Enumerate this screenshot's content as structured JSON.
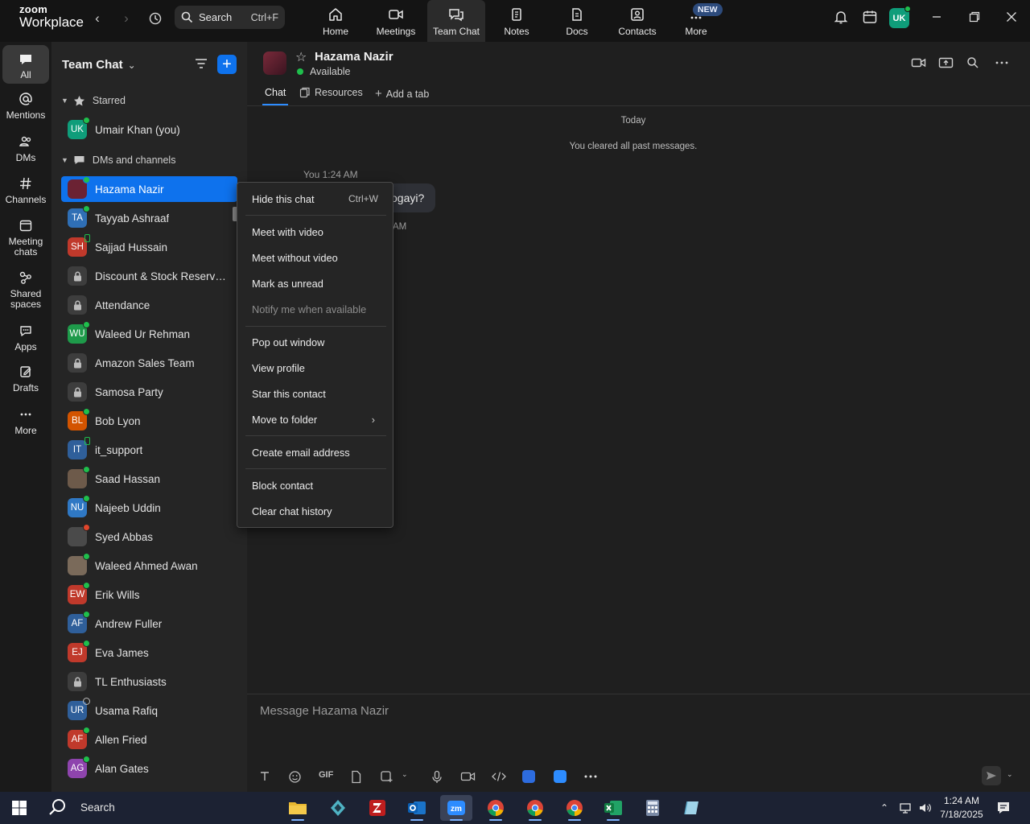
{
  "topbar": {
    "logo_line1": "zoom",
    "logo_line2": "Workplace",
    "search_label": "Search",
    "search_shortcut": "Ctrl+F",
    "nav": [
      {
        "label": "Home",
        "icon": "home-icon"
      },
      {
        "label": "Meetings",
        "icon": "video-icon"
      },
      {
        "label": "Team Chat",
        "icon": "chat-icon"
      },
      {
        "label": "Notes",
        "icon": "notes-icon"
      },
      {
        "label": "Docs",
        "icon": "docs-icon"
      },
      {
        "label": "Contacts",
        "icon": "contacts-icon"
      },
      {
        "label": "More",
        "icon": "more-icon"
      }
    ],
    "new_badge": "NEW",
    "user_initials": "UK"
  },
  "rail": [
    {
      "label": "All"
    },
    {
      "label": "Mentions"
    },
    {
      "label": "DMs"
    },
    {
      "label": "Channels"
    },
    {
      "label": "Meeting chats"
    },
    {
      "label": "Shared spaces"
    },
    {
      "label": "Apps"
    },
    {
      "label": "Drafts"
    },
    {
      "label": "More"
    }
  ],
  "panel": {
    "title": "Team Chat",
    "section_starred": "Starred",
    "section_dms": "DMs and channels",
    "starred": [
      {
        "name": "Umair Khan (you)",
        "initials": "UK",
        "color": "#0f9d7a",
        "status": "online"
      }
    ],
    "items": [
      {
        "name": "Hazama Nazir",
        "initials": "",
        "color": "#6b2233",
        "status": "online",
        "selected": true
      },
      {
        "name": "Tayyab Ashraaf",
        "initials": "TA",
        "color": "#2f6fb5",
        "status": "online"
      },
      {
        "name": "Sajjad Hussain",
        "initials": "SH",
        "color": "#c0392b",
        "status": "mobile"
      },
      {
        "name": "Discount & Stock Reservati...",
        "initials": "",
        "color": "#3d3d3d",
        "status": "lock"
      },
      {
        "name": "Attendance",
        "initials": "",
        "color": "#3d3d3d",
        "status": "lock"
      },
      {
        "name": "Waleed Ur Rehman",
        "initials": "WU",
        "color": "#1e9a4a",
        "status": "online"
      },
      {
        "name": "Amazon Sales Team",
        "initials": "",
        "color": "#3d3d3d",
        "status": "lock"
      },
      {
        "name": "Samosa Party",
        "initials": "",
        "color": "#3d3d3d",
        "status": "lock"
      },
      {
        "name": "Bob Lyon",
        "initials": "BL",
        "color": "#d35400",
        "status": "online"
      },
      {
        "name": "it_support",
        "initials": "IT",
        "color": "#2f5f9a",
        "status": "mobile"
      },
      {
        "name": "Saad Hassan",
        "initials": "",
        "color": "#6d5a4a",
        "status": "online"
      },
      {
        "name": "Najeeb Uddin",
        "initials": "NU",
        "color": "#2f78c4",
        "status": "online"
      },
      {
        "name": "Syed Abbas",
        "initials": "",
        "color": "#4a4a4a",
        "status": "busy"
      },
      {
        "name": "Waleed Ahmed Awan",
        "initials": "",
        "color": "#7a6a5a",
        "status": "online"
      },
      {
        "name": "Erik Wills",
        "initials": "EW",
        "color": "#c0392b",
        "status": "online"
      },
      {
        "name": "Andrew Fuller",
        "initials": "AF",
        "color": "#2f5f9a",
        "status": "online"
      },
      {
        "name": "Eva James",
        "initials": "EJ",
        "color": "#c0392b",
        "status": "online"
      },
      {
        "name": "TL Enthusiasts",
        "initials": "",
        "color": "#3d3d3d",
        "status": "lock"
      },
      {
        "name": "Usama Rafiq",
        "initials": "UR",
        "color": "#2f5f9a",
        "status": "offline"
      },
      {
        "name": "Allen Fried",
        "initials": "AF",
        "color": "#c0392b",
        "status": "online"
      },
      {
        "name": "Alan Gates",
        "initials": "AG",
        "color": "#8e44ad",
        "status": "online"
      }
    ]
  },
  "chat": {
    "name": "Hazama Nazir",
    "status": "Available",
    "tabs": {
      "chat": "Chat",
      "resources": "Resources",
      "add": "Add a tab"
    },
    "today": "Today",
    "cleared": "You cleared all past messages.",
    "msg_meta": "You 1:24 AM",
    "msg_text": "ogayi?",
    "msg_meta2": "AM",
    "composer_placeholder": "Message Hazama Nazir",
    "gif_label": "GIF"
  },
  "context_menu": {
    "hide": "Hide this chat",
    "hide_shortcut": "Ctrl+W",
    "meet_video": "Meet with video",
    "meet_no_video": "Meet without video",
    "mark_unread": "Mark as unread",
    "notify": "Notify me when available",
    "pop_out": "Pop out window",
    "view_profile": "View profile",
    "star": "Star this contact",
    "move_folder": "Move to folder",
    "create_email": "Create email address",
    "block": "Block contact",
    "clear": "Clear chat history"
  },
  "taskbar": {
    "search": "Search",
    "time": "1:24 AM",
    "date": "7/18/2025"
  },
  "colors": {
    "accent": "#0e72ed",
    "online": "#1fbf4c",
    "busy": "#e0452b"
  }
}
